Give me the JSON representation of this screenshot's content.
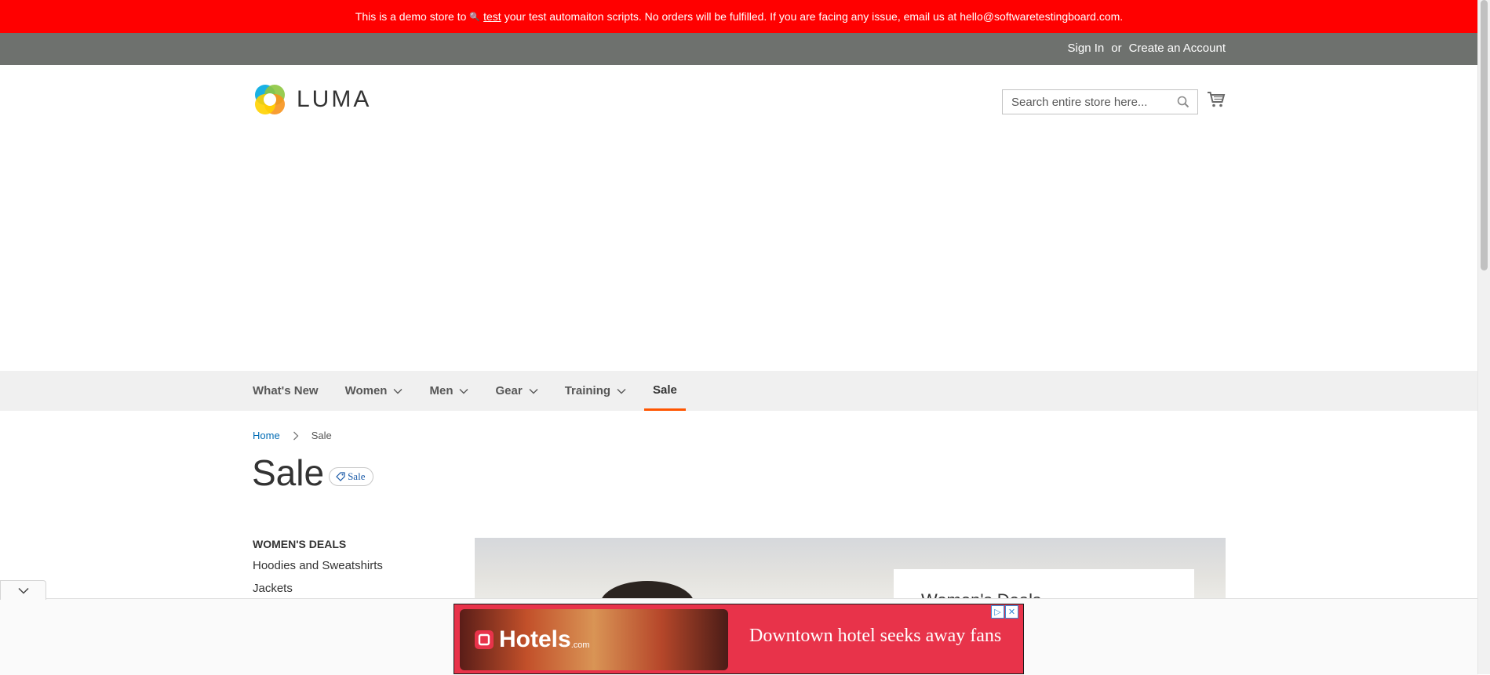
{
  "demo_notice": {
    "text_before": "This is a demo store to",
    "link_text": "test",
    "text_after": "your test automaiton scripts. No orders will be fulfilled. If you are facing any issue, email us at hello@softwaretestingboard.com.",
    "bg_color": "#ff0000"
  },
  "header_links": {
    "sign_in": "Sign In",
    "or": "or",
    "create_account": "Create an Account"
  },
  "logo": {
    "text": "LUMA"
  },
  "search": {
    "placeholder": "Search entire store here..."
  },
  "nav": {
    "items": [
      {
        "label": "What's New",
        "has_dropdown": false
      },
      {
        "label": "Women",
        "has_dropdown": true
      },
      {
        "label": "Men",
        "has_dropdown": true
      },
      {
        "label": "Gear",
        "has_dropdown": true
      },
      {
        "label": "Training",
        "has_dropdown": true
      },
      {
        "label": "Sale",
        "has_dropdown": false,
        "active": true
      }
    ],
    "active_color": "#ff5501"
  },
  "breadcrumb": {
    "home": "Home",
    "current": "Sale"
  },
  "page": {
    "title": "Sale",
    "tag": "Sale"
  },
  "sidebar": {
    "title": "WOMEN'S DEALS",
    "links": [
      "Hoodies and Sweatshirts",
      "Jackets"
    ]
  },
  "hero": {
    "card_title": "Women's Deals"
  },
  "ad": {
    "brand": "Hotels",
    "brand_suffix": ".com",
    "text": "Downtown hotel seeks away fans",
    "bg_color": "#e8334a"
  }
}
